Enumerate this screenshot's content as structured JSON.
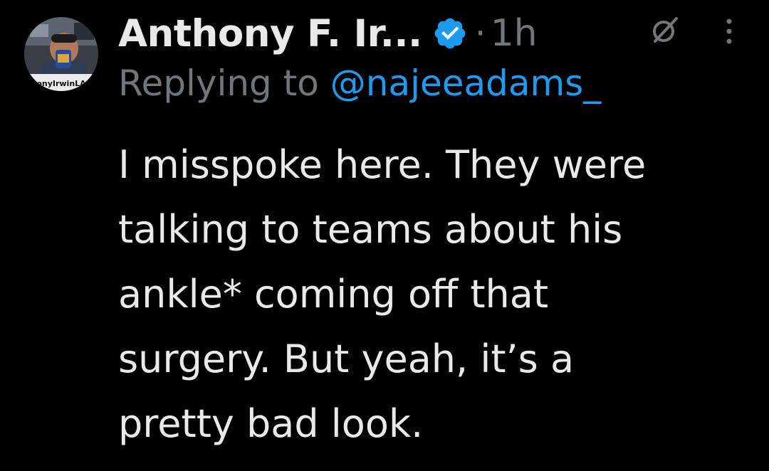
{
  "author": {
    "display_name": "Anthony F. Ir...",
    "avatar_caption": "onyIrwinLA",
    "verified": true,
    "verified_color": "#1d9bf0"
  },
  "meta": {
    "separator": "·",
    "timestamp": "1h"
  },
  "reply": {
    "prefix": "Replying to ",
    "handle": "@najeeadams_"
  },
  "tweet": {
    "text": "I misspoke here. They were\ntalking to teams about his\nankle* coming off that\nsurgery. But yeah, it’s a\npretty bad look."
  },
  "icons": {
    "verified": "verified-badge-icon",
    "grok": "grok-icon",
    "more": "more-options-icon"
  },
  "colors": {
    "background": "#000000",
    "text_primary": "#e7e9ea",
    "text_secondary": "#71767b",
    "accent": "#1d9bf0"
  }
}
